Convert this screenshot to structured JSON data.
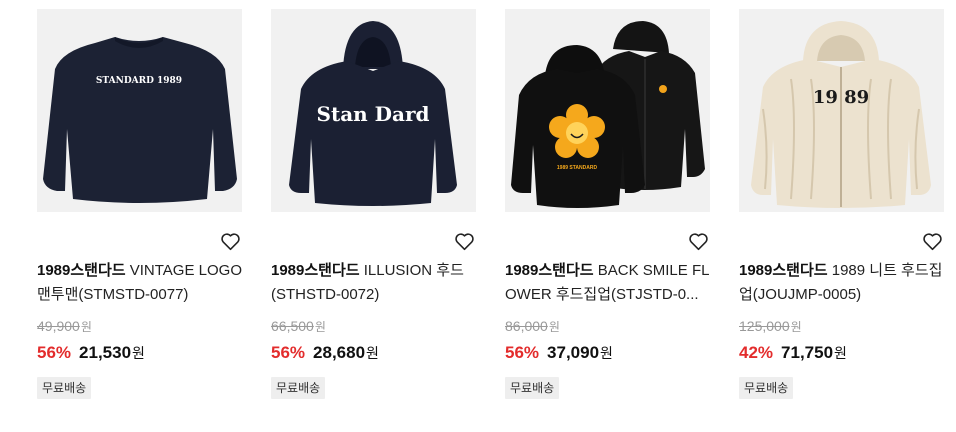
{
  "currency_unit": "원",
  "products": [
    {
      "brand": "1989스탠다드",
      "name": " VINTAGE LOGO 맨투맨(STMSTD-0077)",
      "original_price": "49,900",
      "discount_rate": "56%",
      "sale_price": "21,530",
      "badge": "무료배송",
      "image_label": "STANDARD 1989",
      "image_desc": "navy-sweatshirt"
    },
    {
      "brand": "1989스탠다드",
      "name": " ILLUSION 후드(STHSTD-0072)",
      "original_price": "66,500",
      "discount_rate": "56%",
      "sale_price": "28,680",
      "badge": "무료배송",
      "image_label": "Stan Dard",
      "image_desc": "navy-hoodie"
    },
    {
      "brand": "1989스탠다드",
      "name": " BACK SMILE FLOWER 후드집업(STJSTD-0...",
      "original_price": "86,000",
      "discount_rate": "56%",
      "sale_price": "37,090",
      "badge": "무료배송",
      "image_label": "1989 STANDARD",
      "image_desc": "black-zip-hoodie"
    },
    {
      "brand": "1989스탠다드",
      "name": " 1989 니트 후드집업(JOUJMP-0005)",
      "original_price": "125,000",
      "discount_rate": "42%",
      "sale_price": "71,750",
      "badge": "무료배송",
      "image_label": "19 89",
      "image_desc": "cream-knit-zip-hoodie"
    }
  ],
  "colors": {
    "discount": "#e32c2c",
    "badge_bg": "#eeeeee",
    "thumb_bg": "#f1f1f1"
  }
}
